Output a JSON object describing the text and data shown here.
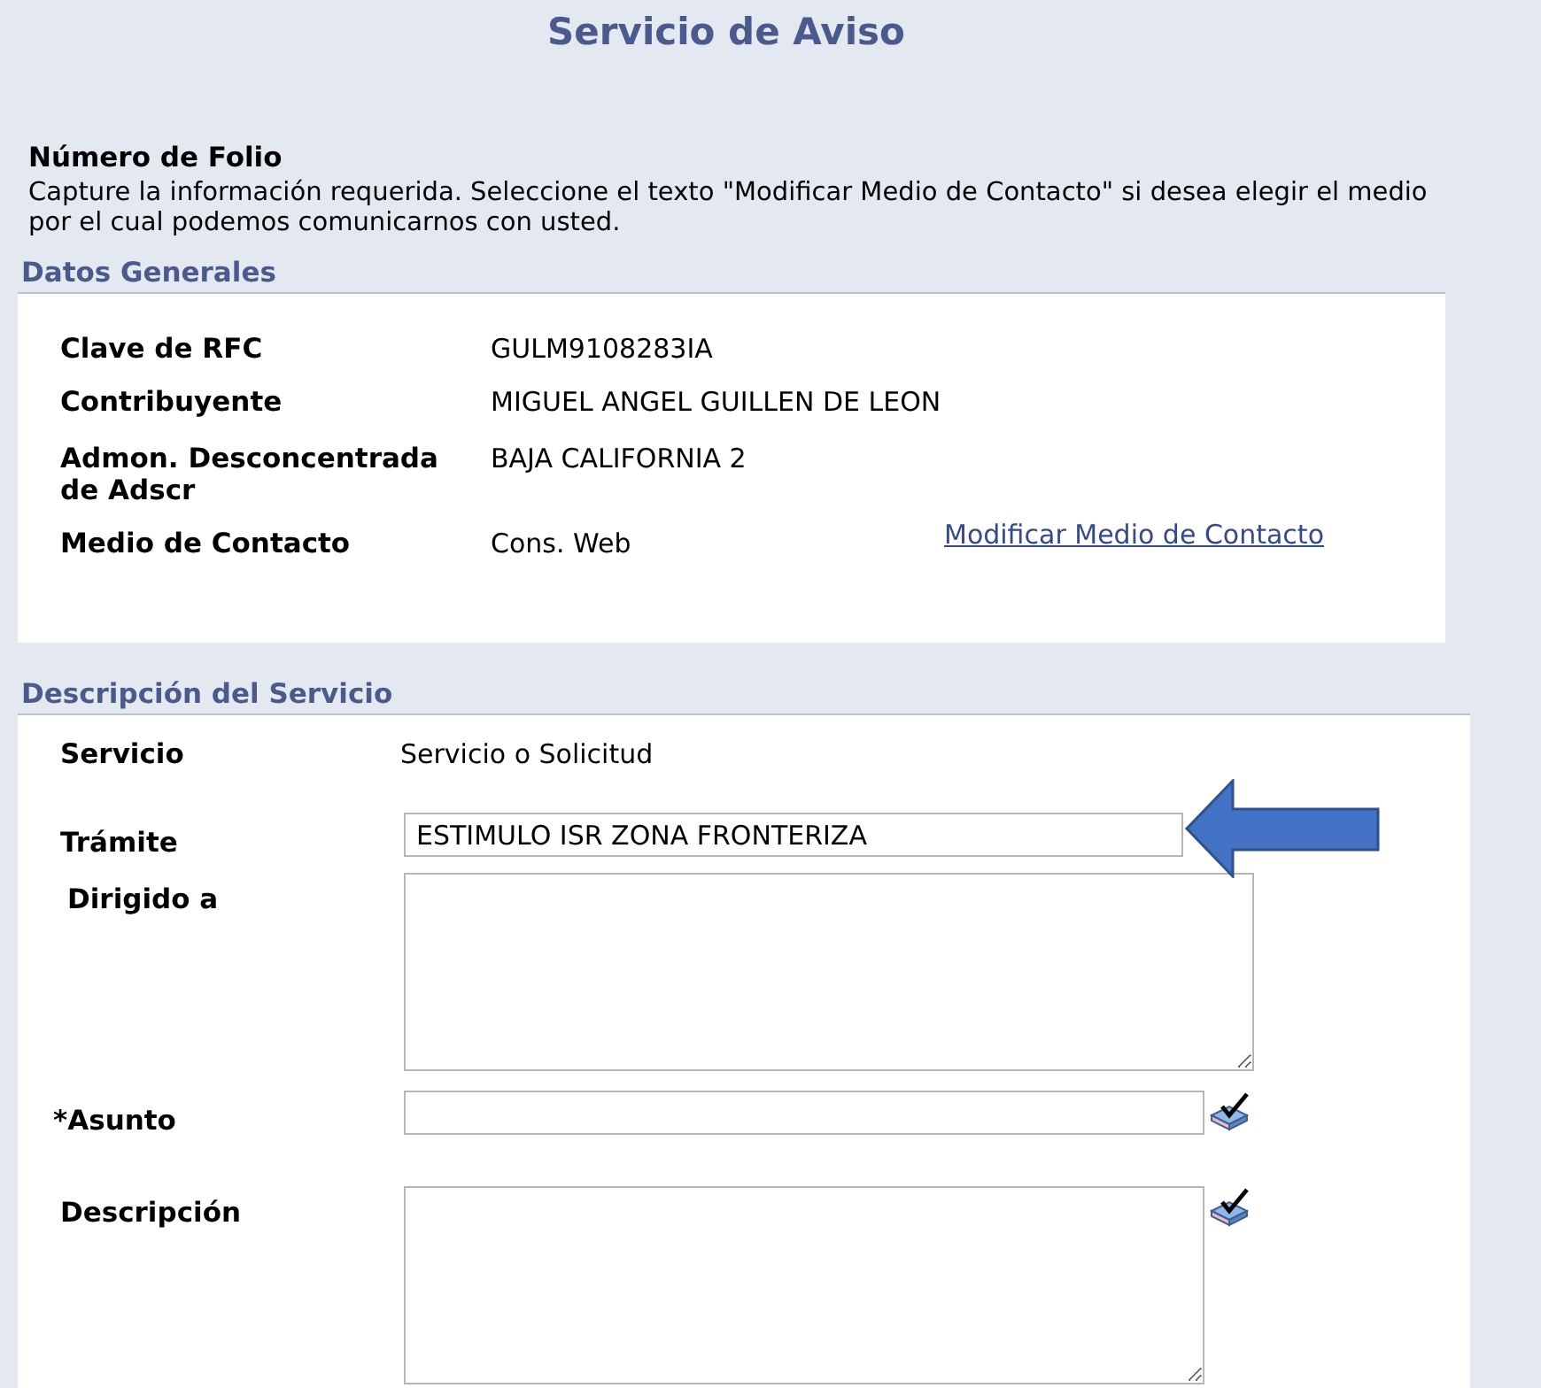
{
  "title": "Servicio de Aviso",
  "folio_heading": "Número de Folio",
  "instructions": "Capture la información requerida. Seleccione el texto \"Modificar Medio de Contacto\" si desea elegir el medio por el cual podemos comunicarnos con usted.",
  "general": {
    "heading": "Datos Generales",
    "rows": [
      {
        "label": "Clave de RFC",
        "value": "GULM9108283IA"
      },
      {
        "label": "Contribuyente",
        "value": "MIGUEL ANGEL GUILLEN DE LEON"
      },
      {
        "label": "Admon. Desconcentrada de Adscr",
        "value": "BAJA CALIFORNIA 2"
      },
      {
        "label": "Medio de Contacto",
        "value": "Cons. Web",
        "link": "Modificar Medio de Contacto"
      }
    ]
  },
  "service": {
    "heading": "Descripción del Servicio",
    "fields": [
      {
        "kind": "text",
        "label": "Servicio",
        "value": "Servicio o Solicitud"
      },
      {
        "kind": "input",
        "label": "Trámite",
        "value": "ESTIMULO ISR ZONA FRONTERIZA",
        "annotated": true
      },
      {
        "kind": "textarea",
        "label": "Dirigido a",
        "spellcheck": false
      },
      {
        "kind": "input",
        "label": "*Asunto",
        "spellcheck": true
      },
      {
        "kind": "textarea",
        "label": "Descripción",
        "spellcheck": true
      }
    ]
  }
}
